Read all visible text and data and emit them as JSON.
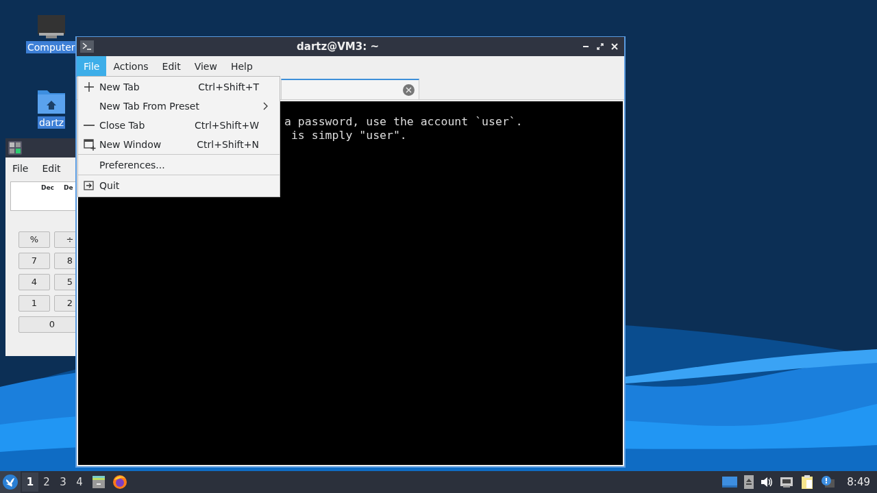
{
  "desktop_icons": [
    {
      "kind": "computer",
      "label": "Computer",
      "selected": true
    },
    {
      "kind": "home",
      "label": "dartz",
      "selected": true
    }
  ],
  "calculator": {
    "menu": [
      "File",
      "Edit"
    ],
    "display_labels": [
      "Dec",
      "De"
    ],
    "keys": [
      {
        "label": "%",
        "wide": false
      },
      {
        "label": "÷",
        "wide": false
      },
      {
        "label": "7",
        "wide": false
      },
      {
        "label": "8",
        "wide": false
      },
      {
        "label": "4",
        "wide": false
      },
      {
        "label": "5",
        "wide": false
      },
      {
        "label": "1",
        "wide": false
      },
      {
        "label": "2",
        "wide": false
      },
      {
        "label": "0",
        "wide": true
      }
    ]
  },
  "terminal": {
    "title": "dartz@VM3: ~",
    "menu": [
      {
        "label": "File",
        "selected": true
      },
      {
        "label": "Actions",
        "selected": false
      },
      {
        "label": "Edit",
        "selected": false
      },
      {
        "label": "View",
        "selected": false
      },
      {
        "label": "Help",
        "selected": false
      }
    ],
    "lines": [
      "a password, use the account `user`.",
      "is simply \"user\"."
    ]
  },
  "file_menu": [
    {
      "kind": "add",
      "label": "New Tab",
      "shortcut": "Ctrl+Shift+T"
    },
    {
      "kind": "submenu",
      "label": "New Tab From Preset"
    },
    {
      "kind": "remove",
      "label": "Close Tab",
      "shortcut": "Ctrl+Shift+W"
    },
    {
      "kind": "window",
      "label": "New Window",
      "shortcut": "Ctrl+Shift+N"
    },
    {
      "kind": "separator"
    },
    {
      "kind": "plain",
      "label": "Preferences..."
    },
    {
      "kind": "separator"
    },
    {
      "kind": "exit",
      "label": "Quit"
    }
  ],
  "taskbar": {
    "workspaces": [
      {
        "label": "1",
        "selected": true
      },
      {
        "label": "2",
        "selected": false
      },
      {
        "label": "3",
        "selected": false
      },
      {
        "label": "4",
        "selected": false
      }
    ],
    "clock": "8:49"
  }
}
